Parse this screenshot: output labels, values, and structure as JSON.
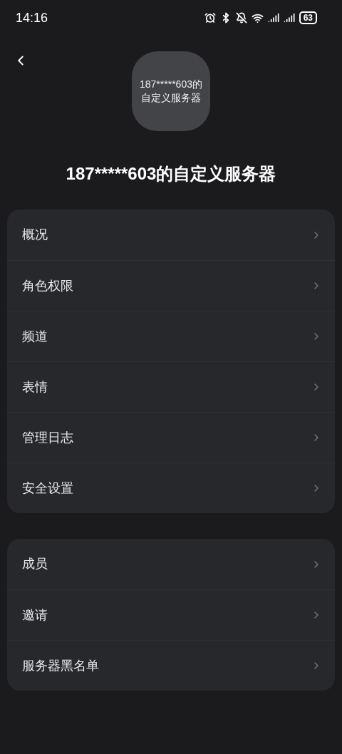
{
  "status_bar": {
    "time": "14:16",
    "battery": "63"
  },
  "server": {
    "icon_lines": [
      "187*****603的",
      "自定义服务器"
    ],
    "name": "187*****603的自定义服务器"
  },
  "groups": [
    {
      "items": [
        {
          "label": "概况"
        },
        {
          "label": "角色权限"
        },
        {
          "label": "频道"
        },
        {
          "label": "表情"
        },
        {
          "label": "管理日志"
        },
        {
          "label": "安全设置"
        }
      ]
    },
    {
      "items": [
        {
          "label": "成员"
        },
        {
          "label": "邀请"
        },
        {
          "label": "服务器黑名单"
        }
      ]
    }
  ]
}
